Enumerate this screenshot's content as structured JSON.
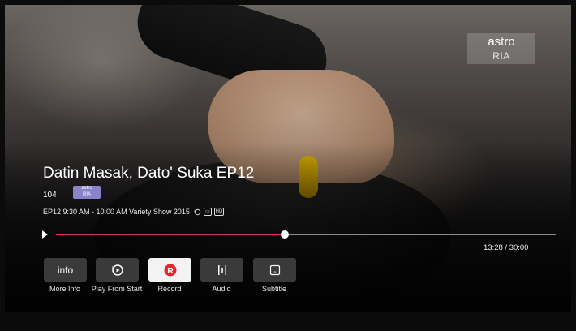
{
  "channel_overlay": {
    "line1": "astro",
    "line2": "RIA"
  },
  "program": {
    "title": "Datin Masak, Dato' Suka EP12",
    "channel_number": "104",
    "channel_logo": {
      "line1": "astro",
      "line2": "RIA"
    },
    "info": "EP12 9:30 AM - 10:00 AM Variety Show 2015",
    "badges": [
      "replay-icon",
      "subtitle-icon",
      "hd-icon"
    ]
  },
  "playback": {
    "progress": 0.458,
    "time": "13:28 / 30:00"
  },
  "actions": [
    {
      "name": "more-info",
      "icon_text": "info",
      "label": "More Info"
    },
    {
      "name": "play-from-start",
      "icon": "replay-icon",
      "label": "Play From Start"
    },
    {
      "name": "record",
      "icon": "record-icon",
      "label": "Record",
      "active": true
    },
    {
      "name": "audio",
      "icon": "audio-icon",
      "label": "Audio"
    },
    {
      "name": "subtitle",
      "icon": "subtitle-icon",
      "label": "Subtitle"
    }
  ],
  "colors": {
    "accent": "#d92f6b",
    "record": "#e3262d",
    "logo_bg": "#8b83c9"
  }
}
